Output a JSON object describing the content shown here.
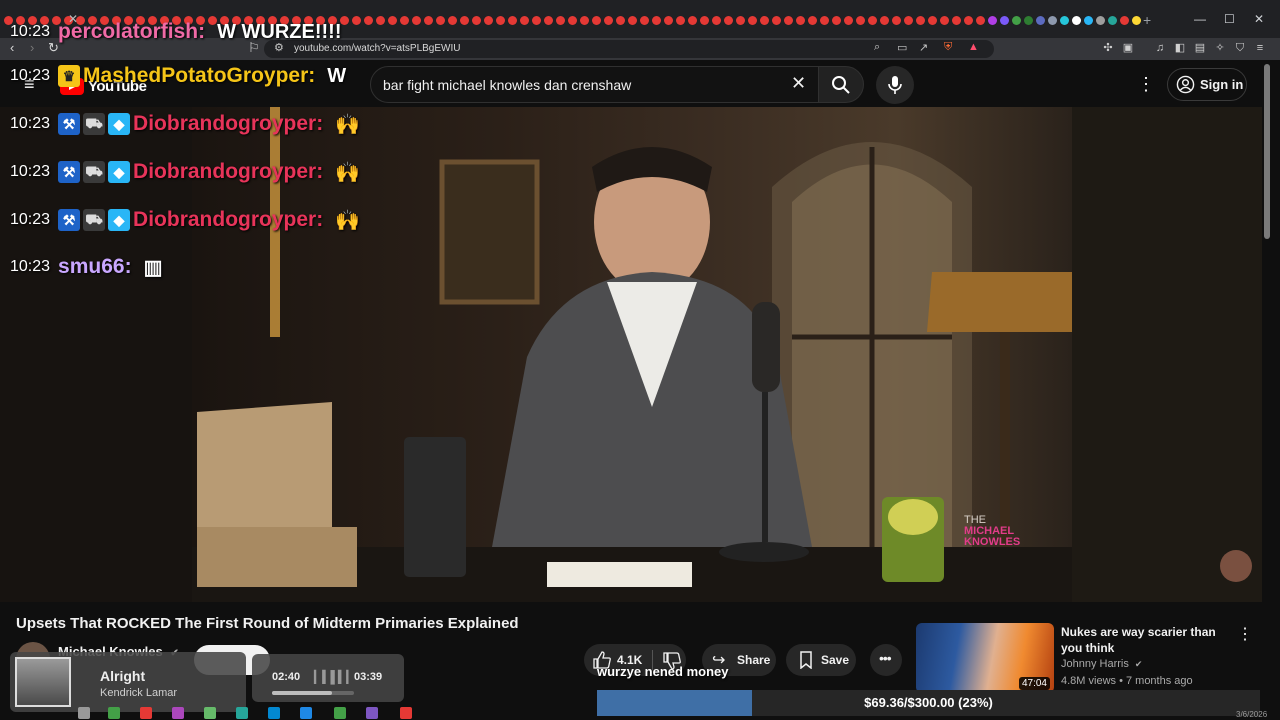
{
  "browser": {
    "url": "youtube.com/watch?v=atsPLBgEWIU",
    "tab_dot_colors": [
      "#e53935",
      "#e53935",
      "#e53935",
      "#e53935",
      "#e53935",
      "#e53935",
      "#e53935",
      "#e53935",
      "#e53935",
      "#e53935",
      "#e53935",
      "#e53935",
      "#e53935",
      "#e53935",
      "#e53935",
      "#e53935",
      "#e53935",
      "#e53935",
      "#e53935",
      "#e53935",
      "#e53935",
      "#e53935",
      "#e53935",
      "#e53935",
      "#e53935",
      "#e53935",
      "#e53935",
      "#e53935",
      "#e53935",
      "#e53935",
      "#e53935",
      "#e53935",
      "#e53935",
      "#e53935",
      "#e53935",
      "#e53935",
      "#e53935",
      "#e53935",
      "#e53935",
      "#e53935",
      "#e53935",
      "#e53935",
      "#e53935",
      "#e53935",
      "#e53935",
      "#e53935",
      "#e53935",
      "#e53935",
      "#e53935",
      "#e53935",
      "#e53935",
      "#e53935",
      "#e53935",
      "#e53935",
      "#e53935",
      "#e53935",
      "#e53935",
      "#e53935",
      "#e53935",
      "#e53935",
      "#e53935",
      "#e53935",
      "#e53935",
      "#e53935",
      "#e53935",
      "#e53935",
      "#e53935",
      "#e53935",
      "#e53935",
      "#e53935",
      "#e53935",
      "#e53935",
      "#e53935",
      "#e53935",
      "#e53935",
      "#e53935",
      "#e53935",
      "#e53935",
      "#e53935",
      "#e53935",
      "#e53935",
      "#e53935",
      "#b03ee5",
      "#7a5af8",
      "#43a047",
      "#2e7d32",
      "#5c6bc0",
      "#8d99ae",
      "#26c6da",
      "#ffffff",
      "#29b6f6",
      "#9e9e9e",
      "#26a69a",
      "#e53935",
      "#fdd835",
      "#ef5350",
      "#ff8a65",
      "#ffb300",
      "#fdd835",
      "#66bb6a",
      "#ffffff",
      "#bdbdbd",
      "#90caf9"
    ]
  },
  "youtube": {
    "logo_text": "YouTube",
    "search_query": "bar fight michael knowles dan crenshaw",
    "signin_label": "Sign in",
    "video_title": "Upsets That ROCKED The First Round of Midterm Primaries Explained",
    "channel_name": "Michael Knowles",
    "like_count": "4.1K",
    "share_label": "Share",
    "save_label": "Save",
    "watermark": [
      "THE",
      "MICHAEL",
      "KNOWLES"
    ],
    "recommendation": {
      "title": "Nukes are way scarier than you think",
      "channel": "Johnny Harris",
      "meta": "4.8M views • 7 months ago",
      "duration": "47:04"
    }
  },
  "chat": [
    {
      "time": "10:23",
      "user": "percolatorfish:",
      "user_color": "#f06aa6",
      "message": "W WURZE!!!!",
      "badges": [],
      "emote": ""
    },
    {
      "time": "10:23",
      "user": "MashedPotatoGroyper:",
      "user_color": "#f5c518",
      "message": "W",
      "badges": [
        "crown"
      ],
      "emote": ""
    },
    {
      "time": "10:23",
      "user": "Diobrandogroyper:",
      "user_color": "#e8345a",
      "message": "",
      "badges": [
        "hammer",
        "car",
        "cube"
      ],
      "emote": "hands"
    },
    {
      "time": "10:23",
      "user": "Diobrandogroyper:",
      "user_color": "#e8345a",
      "message": "",
      "badges": [
        "hammer",
        "car",
        "cube"
      ],
      "emote": "hands"
    },
    {
      "time": "10:23",
      "user": "Diobrandogroyper:",
      "user_color": "#e8345a",
      "message": "",
      "badges": [
        "hammer",
        "car",
        "cube"
      ],
      "emote": "hands"
    },
    {
      "time": "10:23",
      "user": "smu66:",
      "user_color": "#c9a7ff",
      "message": "",
      "badges": [],
      "emote": "book"
    }
  ],
  "music": {
    "track": "Alright",
    "artist": "Kendrick Lamar",
    "elapsed": "02:40",
    "total": "03:39",
    "progress": 0.73
  },
  "stream": {
    "donation_message": "wurzye nened money",
    "goal_label": "$69.36/$300.00 (23%)",
    "goal_fraction": 0.23,
    "corner_date": "3/6/2026"
  }
}
